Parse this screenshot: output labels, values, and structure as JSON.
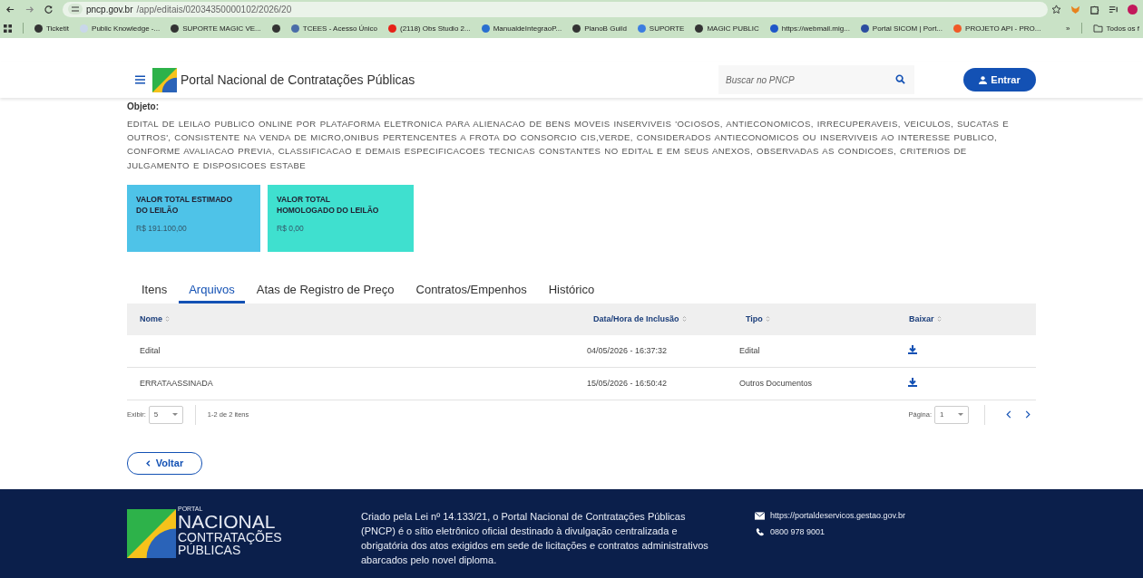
{
  "browser": {
    "url_host": "pncp.gov.br",
    "url_path": "/app/editais/02034350000102/2026/20",
    "bookmarks": [
      {
        "label": "Ticketit",
        "color": "#333333"
      },
      {
        "label": "Public Knowledge -...",
        "color": "#c9d7ea"
      },
      {
        "label": "SUPORTE MAGIC VE...",
        "color": "#333333"
      },
      {
        "color": "#333333"
      },
      {
        "label": "TCEES - Acesso Único",
        "color": "#4a6da8"
      },
      {
        "label": "(2118) Obs Studio 2...",
        "color": "#e62117"
      },
      {
        "label": "ManualdeIntegraoP...",
        "color": "#2a6fd0"
      },
      {
        "label": "PlanoB Guild",
        "color": "#333333"
      },
      {
        "label": "SUPORTE",
        "color": "#3b7de0"
      },
      {
        "label": "MAGIC PUBLIC",
        "color": "#333333"
      },
      {
        "label": "https://webmail.mig...",
        "color": "#1e56c8"
      },
      {
        "label": "Portal SICOM | Port...",
        "color": "#2c4da0"
      },
      {
        "label": "PROJETO API - PRO...",
        "color": "#f05a28"
      }
    ],
    "overflow": "»",
    "all_bookmarks": "Todos os f"
  },
  "header": {
    "title": "Portal Nacional de Contratações Públicas",
    "search": {
      "placeholder": "Buscar no PNCP"
    },
    "login": "Entrar"
  },
  "objeto": {
    "label": "Objeto:",
    "text": "EDITAL DE LEILAO PUBLICO ONLINE POR PLATAFORMA ELETRONICA PARA ALIENACAO DE BENS MOVEIS INSERVIVEIS 'OCIOSOS, ANTIECONOMICOS, IRRECUPERAVEIS, VEICULOS, SUCATAS E OUTROS', CONSISTENTE NA VENDA DE MICRO,ONIBUS PERTENCENTES A FROTA DO CONSORCIO CIS,VERDE, CONSIDERADOS ANTIECONOMICOS OU INSERVIVEIS AO INTERESSE PUBLICO, CONFORME AVALIACAO PREVIA, CLASSIFICACAO E DEMAIS ESPECIFICACOES TECNICAS CONSTANTES NO EDITAL E EM SEUS ANEXOS, OBSERVADAS AS CONDICOES, CRITERIOS DE JULGAMENTO E DISPOSICOES ESTABE"
  },
  "value_cards": [
    {
      "title": "VALOR TOTAL ESTIMADO DO LEILÃO",
      "value": "R$ 191.100,00",
      "color": "#4ec3e8"
    },
    {
      "title": "VALOR TOTAL HOMOLOGADO DO LEILÃO",
      "value": "R$ 0,00",
      "color": "#3fe0cf"
    }
  ],
  "tabs": [
    {
      "label": "Itens",
      "selected": false
    },
    {
      "label": "Arquivos",
      "selected": true
    },
    {
      "label": "Atas de Registro de Preço",
      "selected": false
    },
    {
      "label": "Contratos/Empenhos",
      "selected": false
    },
    {
      "label": "Histórico",
      "selected": false
    }
  ],
  "table": {
    "columns": [
      "Nome",
      "Data/Hora de Inclusão",
      "Tipo",
      "Baixar"
    ],
    "rows": [
      [
        "Edital",
        "04/05/2026 - 16:37:32",
        "Edital"
      ],
      [
        "ERRATAASSINADA",
        "15/05/2026 - 16:50:42",
        "Outros Documentos"
      ]
    ]
  },
  "pagination": {
    "show_label": "Exibir:",
    "page_size": "5",
    "range": "1-2 de 2 itens",
    "page_label": "Página:",
    "page": "1"
  },
  "back_button": "Voltar",
  "footer": {
    "logo": {
      "small": "PORTAL",
      "big": "NACIONAL",
      "line2": "CONTRATAÇÕES",
      "line3": "PÚBLICAS"
    },
    "about": "Criado pela Lei nº 14.133/21, o Portal Nacional de Contratações Públicas (PNCP) é o sítio eletrônico oficial destinado à divulgação centralizada e obrigatória dos atos exigidos em sede de licitações e contratos administrativos abarcados pelo novel diploma.",
    "link": "https://portaldeservicos.gestao.gov.br",
    "phone": "0800 978 9001"
  }
}
